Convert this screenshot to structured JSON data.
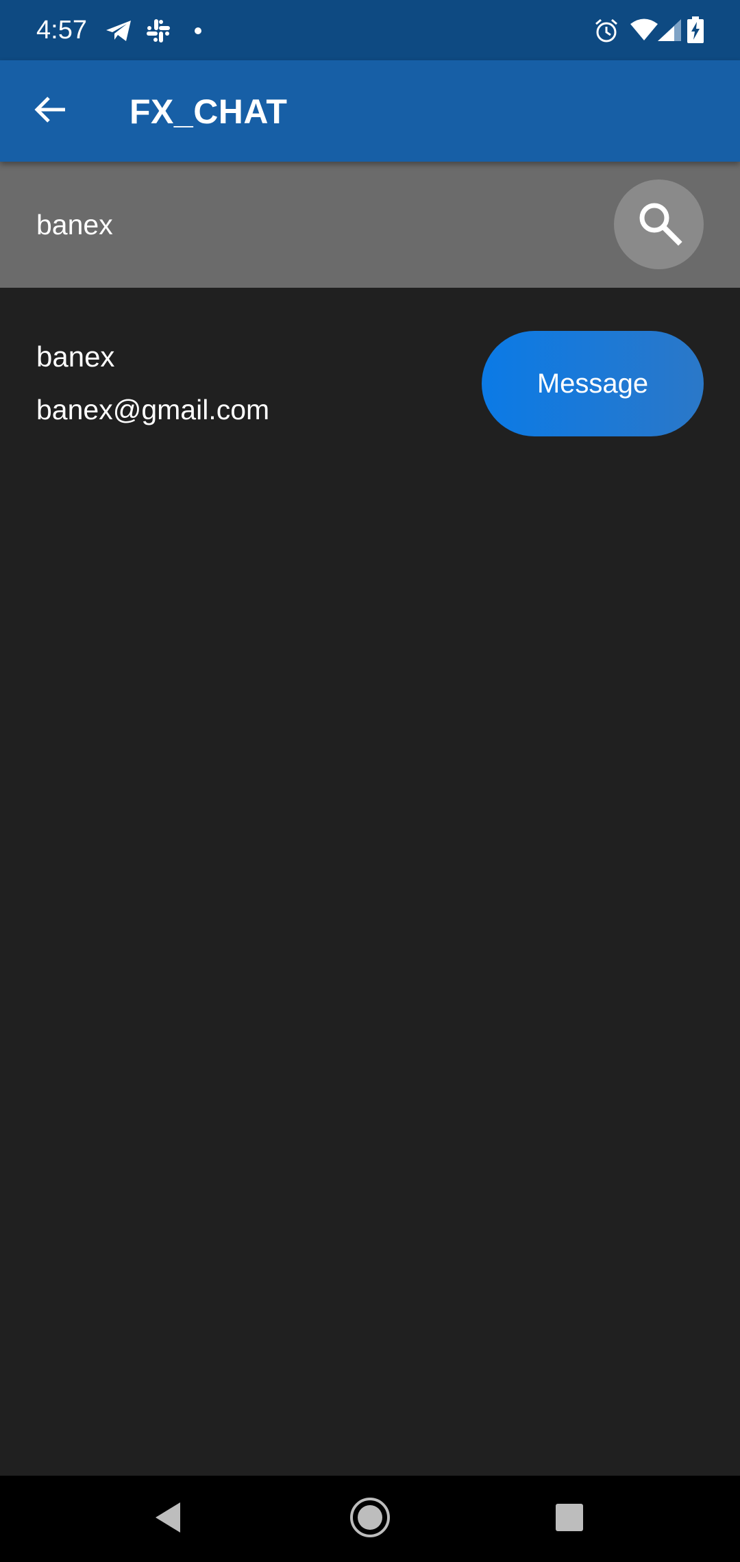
{
  "status_bar": {
    "time": "4:57",
    "left_icons": [
      "telegram-icon",
      "slack-icon",
      "notification-dot-icon"
    ],
    "right_icons": [
      "alarm-icon",
      "wifi-icon",
      "signal-icon",
      "battery-charging-icon"
    ]
  },
  "app_bar": {
    "title": "FX_CHAT",
    "back_icon": "arrow-back-icon",
    "color": "#175fa6"
  },
  "search": {
    "value": "banex",
    "button_icon": "search-icon"
  },
  "results": [
    {
      "name": "banex",
      "email": "banex@gmail.com",
      "action_label": "Message"
    }
  ],
  "nav_bar": {
    "buttons": [
      "back-triangle-icon",
      "home-circle-icon",
      "recents-square-icon"
    ]
  },
  "colors": {
    "background": "#202020",
    "search_bar": "#6b6b6b",
    "accent": "#0b7ae6",
    "status_bar": "#0e4a82"
  }
}
